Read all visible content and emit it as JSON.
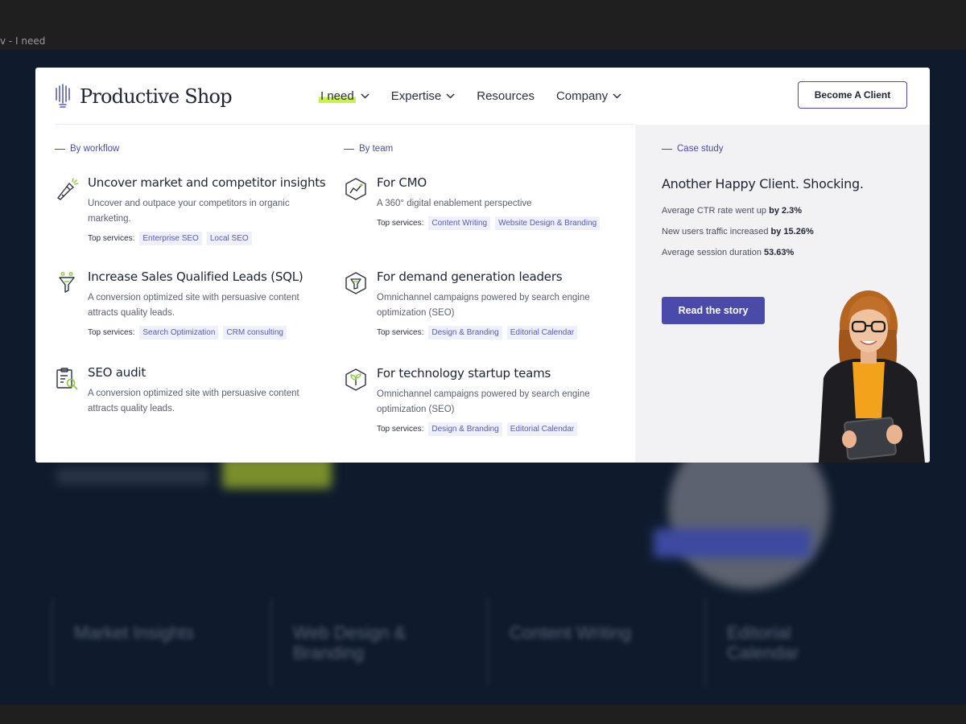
{
  "frame": {
    "label": "v - I need"
  },
  "background": {
    "cards": [
      "Market Insights",
      "Web Design & Branding",
      "Content Writing",
      "Editorial Calendar"
    ]
  },
  "header": {
    "logo_text": "Productive Shop",
    "nav": [
      {
        "label": "I need",
        "has_dropdown": true,
        "active": true
      },
      {
        "label": "Expertise",
        "has_dropdown": true,
        "active": false
      },
      {
        "label": "Resources",
        "has_dropdown": false,
        "active": false
      },
      {
        "label": "Company",
        "has_dropdown": true,
        "active": false
      }
    ],
    "cta_label": "Become A Client"
  },
  "workflow": {
    "title": "By workflow",
    "items": [
      {
        "icon": "flashlight-icon",
        "title": "Uncover market and competitor insights",
        "desc": "Uncover and outpace your competitors in organic marketing.",
        "services_label": "Top services:",
        "services": [
          "Enterprise SEO",
          "Local SEO"
        ]
      },
      {
        "icon": "funnel-icon",
        "title": "Increase Sales Qualified Leads (SQL)",
        "desc": "A conversion optimized site with persuasive content attracts quality leads.",
        "services_label": "Top services:",
        "services": [
          "Search Optimization",
          "CRM consulting"
        ]
      },
      {
        "icon": "clipboard-search-icon",
        "title": "SEO audit",
        "desc": "A conversion optimized site with persuasive content attracts quality leads."
      }
    ]
  },
  "team": {
    "title": "By team",
    "items": [
      {
        "icon": "chart-hexagon-icon",
        "title": "For CMO",
        "desc": "A 360° digital enablement perspective",
        "services_label": "Top services:",
        "services": [
          "Content Writing",
          "Website Design & Branding"
        ]
      },
      {
        "icon": "funnel-hexagon-icon",
        "title": "For demand generation leaders",
        "desc": "Omnichannel campaigns powered by search engine optimization (SEO)",
        "services_label": "Top services:",
        "services": [
          "Design & Branding",
          "Editorial Calendar"
        ]
      },
      {
        "icon": "sprout-hexagon-icon",
        "title": "For technology startup teams",
        "desc": "Omnichannel campaigns powered by search engine optimization (SEO)",
        "services_label": "Top services:",
        "services": [
          "Design & Branding",
          "Editorial Calendar"
        ]
      }
    ]
  },
  "case_study": {
    "label": "Case study",
    "title": "Another Happy Client. Shocking.",
    "stats": [
      {
        "text": "Average CTR rate went up",
        "value": "by 2.3%"
      },
      {
        "text": "New users traffic increased",
        "value": "by 15.26%"
      },
      {
        "text": "Average session duration",
        "value": "53.63%"
      }
    ],
    "button": "Read the story"
  },
  "colors": {
    "accent": "#4a4aa8",
    "highlight": "#c8f24a",
    "page_bg": "#0f1b2d",
    "panel_bg": "#f2f2f4"
  }
}
